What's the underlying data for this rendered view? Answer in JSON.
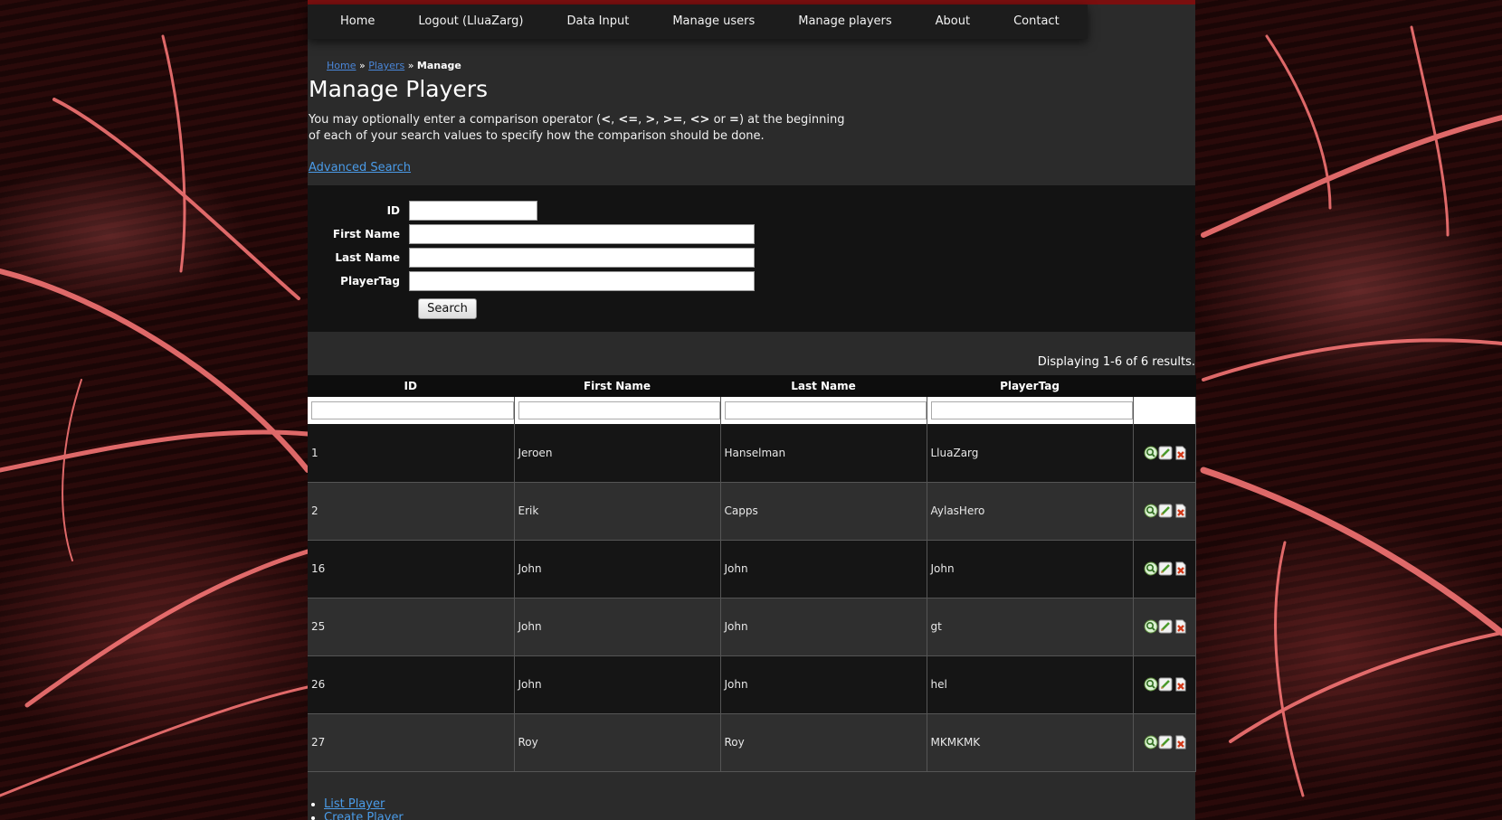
{
  "nav": {
    "items": [
      "Home",
      "Logout (LluaZarg)",
      "Data Input",
      "Manage users",
      "Manage players",
      "About",
      "Contact"
    ]
  },
  "breadcrumb": {
    "home": "Home",
    "players": "Players",
    "current": "Manage",
    "sep": "»"
  },
  "page": {
    "title": "Manage Players",
    "desc_line_prefix": "You may optionally enter a comparison operator (",
    "desc_ops": [
      "<",
      "<=",
      ">",
      ">=",
      "<>",
      "="
    ],
    "desc_suffix": ") at the beginning of each of your search values to specify how the comparison should be done.",
    "advanced_search": "Advanced Search"
  },
  "search_form": {
    "fields": [
      {
        "label": "ID",
        "value": ""
      },
      {
        "label": "First Name",
        "value": ""
      },
      {
        "label": "Last Name",
        "value": ""
      },
      {
        "label": "PlayerTag",
        "value": ""
      }
    ],
    "button": "Search"
  },
  "results": {
    "summary": "Displaying 1-6 of 6 results.",
    "columns": [
      "ID",
      "First Name",
      "Last Name",
      "PlayerTag"
    ],
    "rows": [
      [
        "1",
        "Jeroen",
        "Hanselman",
        "LluaZarg"
      ],
      [
        "2",
        "Erik",
        "Capps",
        "AylasHero"
      ],
      [
        "16",
        "John",
        "John",
        "John"
      ],
      [
        "25",
        "John",
        "John",
        "gt"
      ],
      [
        "26",
        "John",
        "John",
        "hel"
      ],
      [
        "27",
        "Roy",
        "Roy",
        "MKMKMK"
      ]
    ]
  },
  "links": [
    "List Player",
    "Create Player"
  ],
  "icons": {
    "view": "view-icon",
    "update": "update-icon",
    "delete": "delete-icon"
  },
  "colors": {
    "accent_bar": "#7a0f0f",
    "link": "#4a9be8"
  }
}
